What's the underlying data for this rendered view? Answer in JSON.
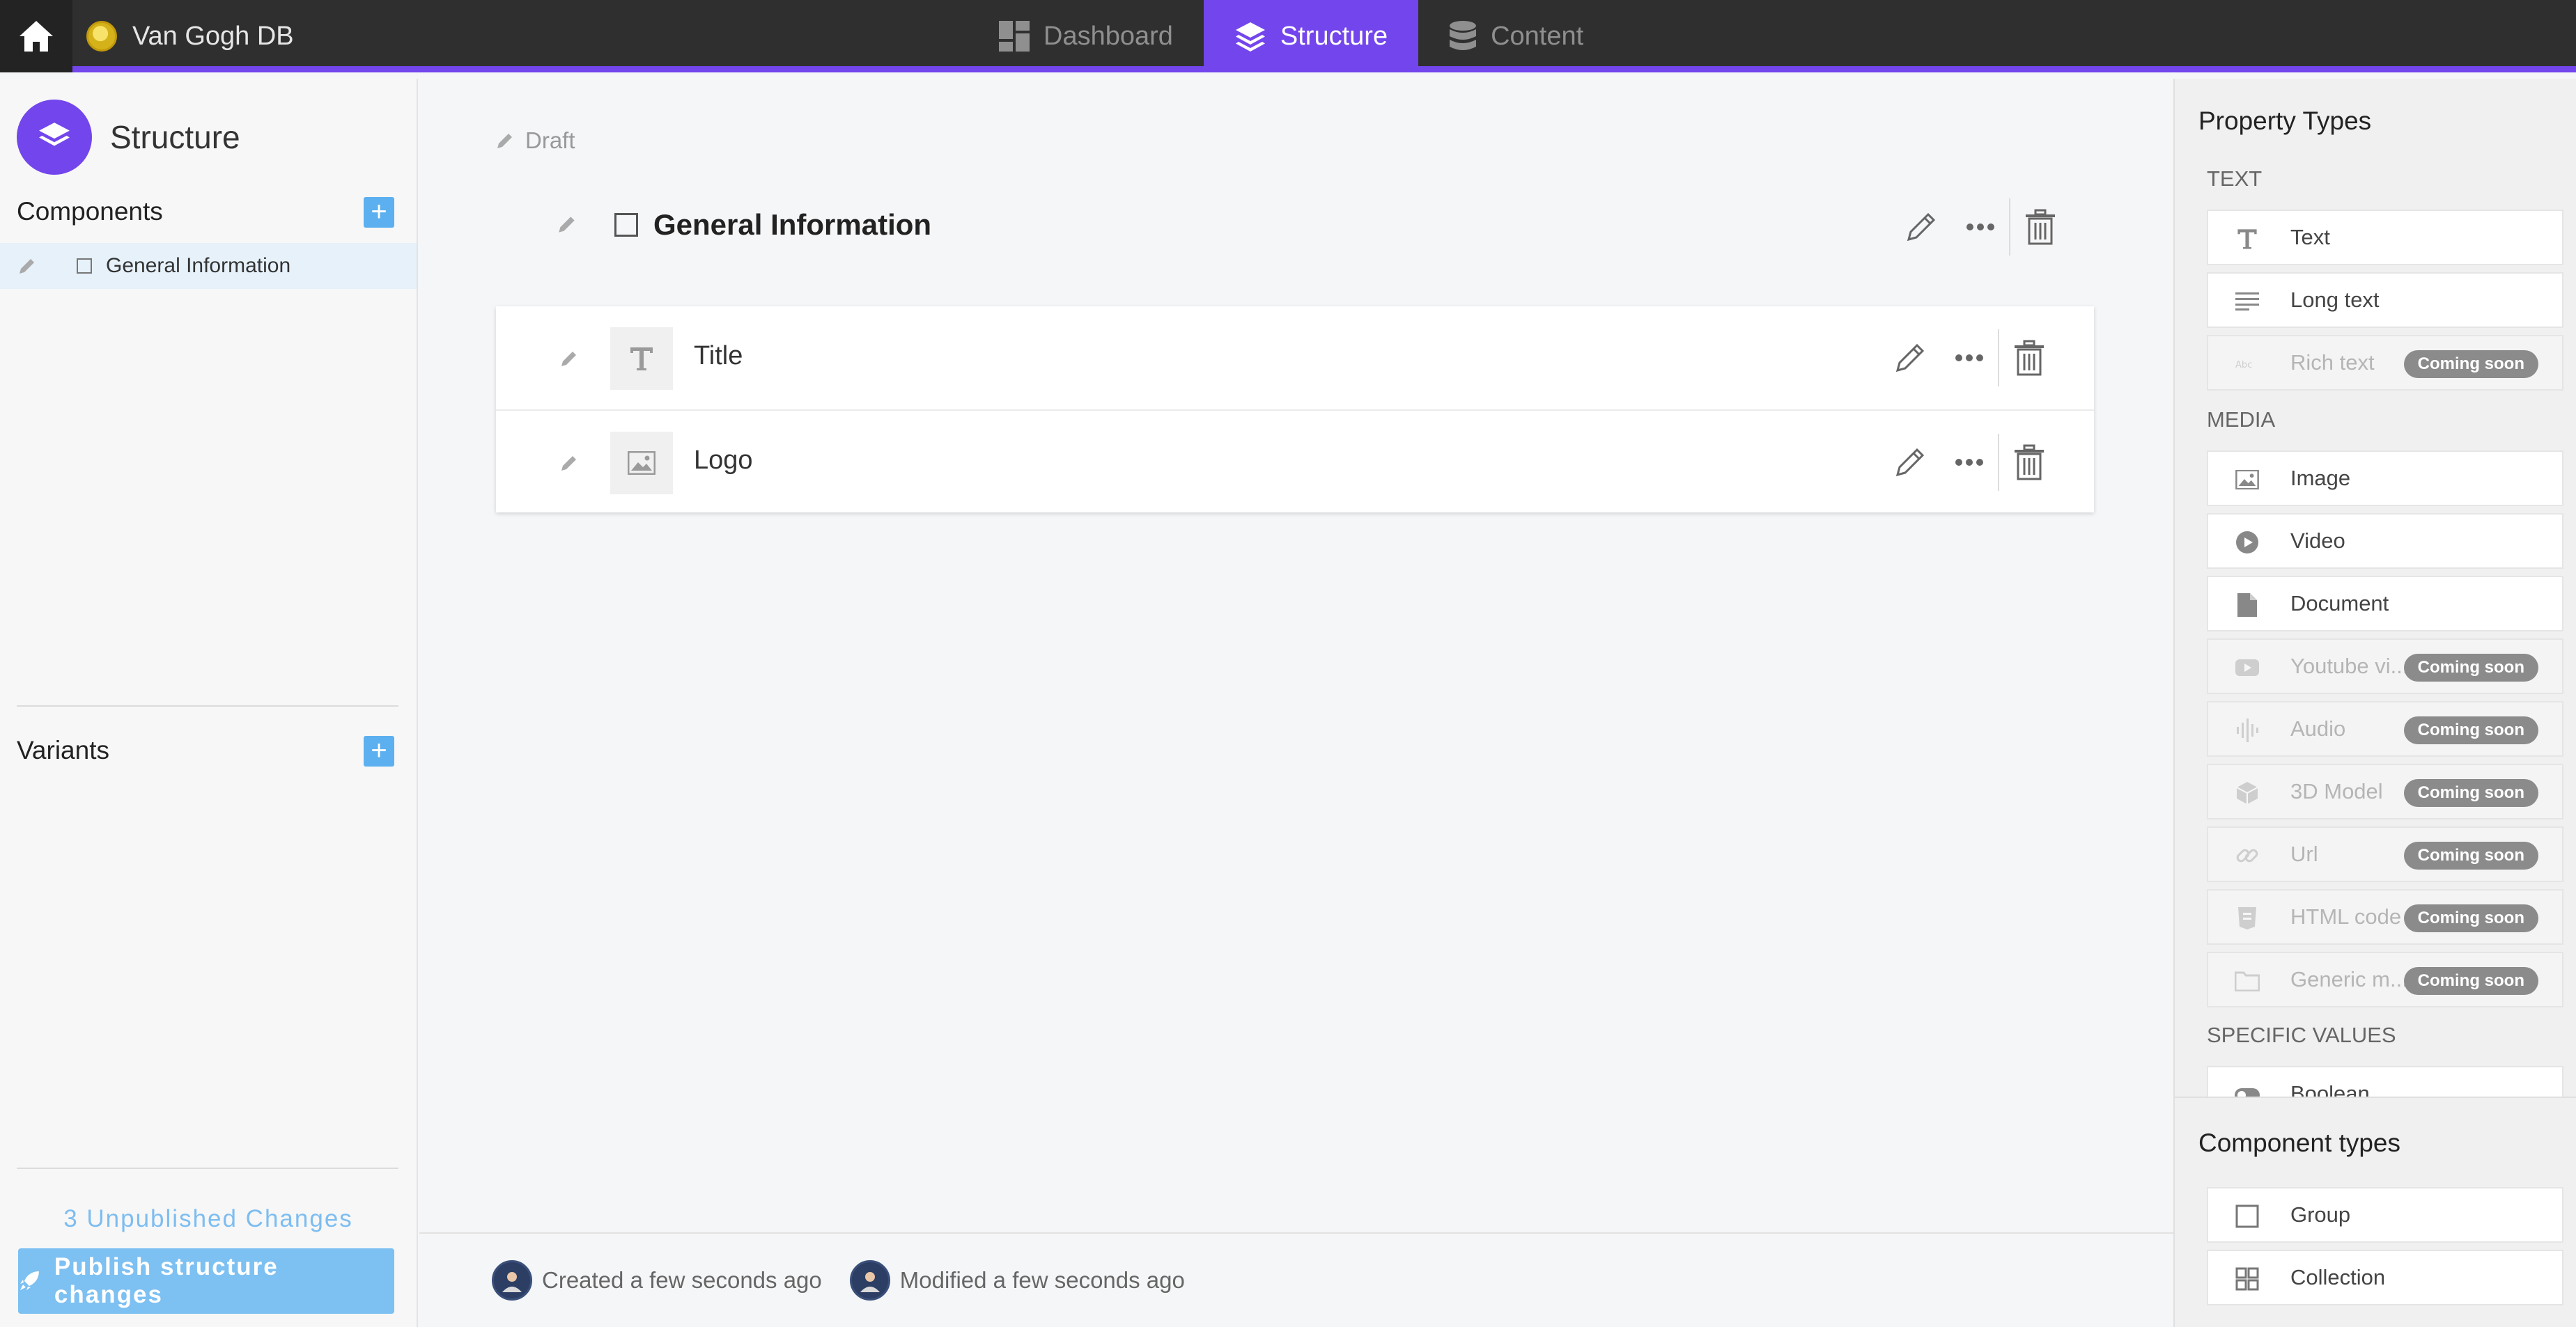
{
  "topbar": {
    "app_name": "Van Gogh DB",
    "tabs": [
      {
        "label": "Dashboard",
        "icon": "dashboard-icon",
        "active": false
      },
      {
        "label": "Structure",
        "icon": "layers-icon",
        "active": true
      },
      {
        "label": "Content",
        "icon": "database-icon",
        "active": false
      }
    ],
    "accent": "#7345ec"
  },
  "sidebar": {
    "title": "Structure",
    "components_title": "Components",
    "components": [
      {
        "label": "General Information"
      }
    ],
    "variants_title": "Variants",
    "unpublished": "3 Unpublished Changes",
    "publish_label": "Publish structure changes"
  },
  "main": {
    "status": "Draft",
    "group_name": "General Information",
    "fields": [
      {
        "name": "Title",
        "type_icon": "text-type-icon"
      },
      {
        "name": "Logo",
        "type_icon": "image-type-icon"
      }
    ],
    "footer": {
      "created": "Created a few seconds ago",
      "modified": "Modified a few seconds ago"
    }
  },
  "property_types": {
    "title": "Property Types",
    "categories": [
      {
        "name": "TEXT",
        "items": [
          {
            "label": "Text",
            "icon": "text-icon",
            "enabled": true
          },
          {
            "label": "Long text",
            "icon": "long-text-icon",
            "enabled": true
          },
          {
            "label": "Rich text",
            "icon": "rich-text-icon",
            "enabled": false
          }
        ]
      },
      {
        "name": "MEDIA",
        "items": [
          {
            "label": "Image",
            "icon": "image-icon",
            "enabled": true
          },
          {
            "label": "Video",
            "icon": "video-icon",
            "enabled": true
          },
          {
            "label": "Document",
            "icon": "document-icon",
            "enabled": true
          },
          {
            "label": "Youtube vi...",
            "icon": "youtube-icon",
            "enabled": false
          },
          {
            "label": "Audio",
            "icon": "audio-icon",
            "enabled": false
          },
          {
            "label": "3D Model",
            "icon": "cube-icon",
            "enabled": false
          },
          {
            "label": "Url",
            "icon": "link-icon",
            "enabled": false
          },
          {
            "label": "HTML code",
            "icon": "html-icon",
            "enabled": false
          },
          {
            "label": "Generic m...",
            "icon": "folder-icon",
            "enabled": false
          }
        ]
      },
      {
        "name": "SPECIFIC VALUES",
        "items": [
          {
            "label": "Boolean",
            "icon": "toggle-icon",
            "enabled": true
          }
        ]
      }
    ],
    "coming_soon": "Coming soon"
  },
  "component_types": {
    "title": "Component types",
    "items": [
      {
        "label": "Group",
        "icon": "group-icon"
      },
      {
        "label": "Collection",
        "icon": "collection-icon"
      }
    ]
  }
}
